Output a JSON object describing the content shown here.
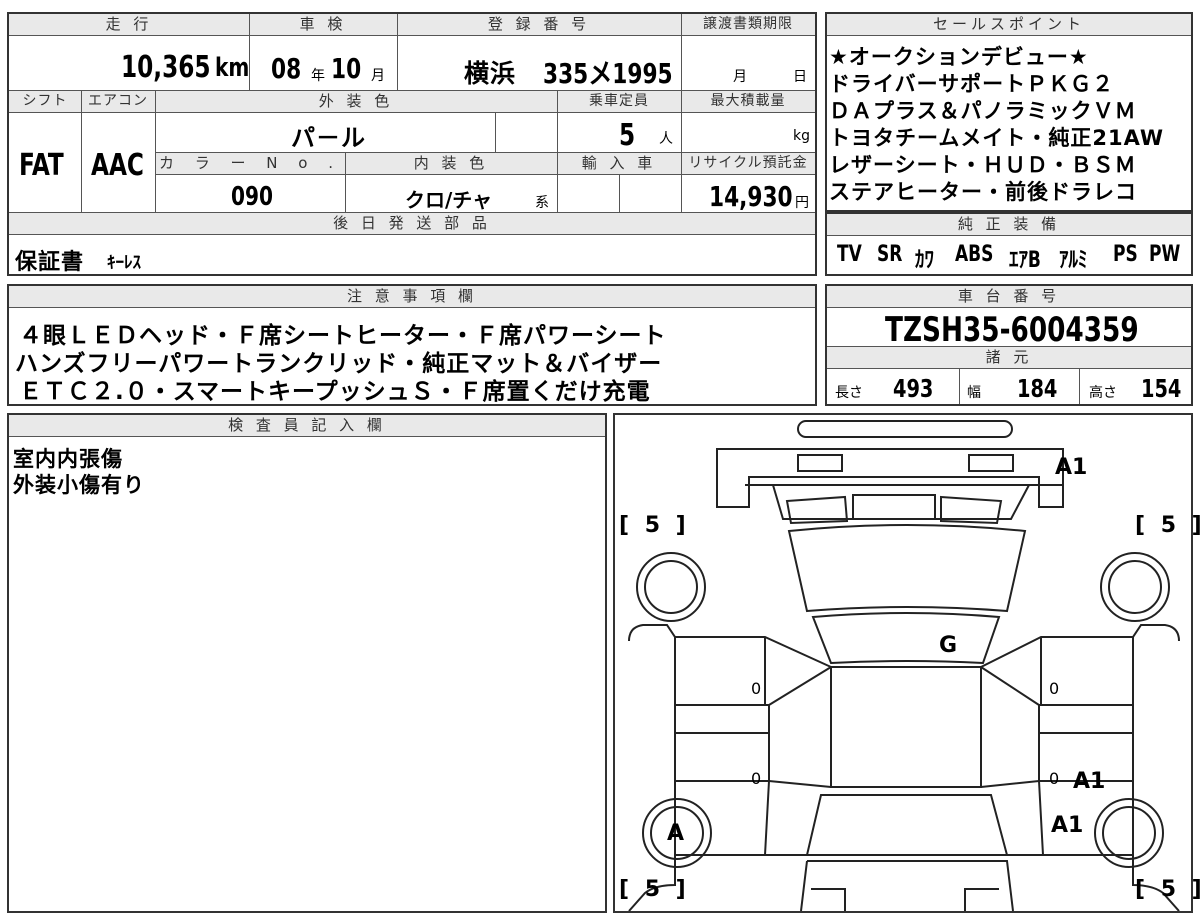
{
  "vehicle": {
    "header_mileage": "走 行",
    "mileage_value": "10,365",
    "mileage_unit": "km",
    "header_inspection": "車 検",
    "inspection_year": "08",
    "inspection_year_unit": "年",
    "inspection_month": "10",
    "inspection_month_unit": "月",
    "header_registration": "登 録 番 号",
    "registration_area": "横浜",
    "registration_number": "335メ1995",
    "header_transfer": "譲渡書類期限",
    "transfer_month_unit": "月",
    "transfer_day_unit": "日",
    "header_shift": "シフト",
    "header_aircon": "エアコン",
    "header_exterior_color": "外 装 色",
    "header_capacity": "乗車定員",
    "header_max_load": "最大積載量",
    "shift_value": "FAT",
    "aircon_value": "AAC",
    "exterior_color_value": "パ－ル",
    "capacity_value": "5",
    "capacity_unit": "人",
    "max_load_unit": "kg",
    "header_color_no": "カ ラ ー N o .",
    "header_interior_color": "内 装 色",
    "header_import": "輸 入 車",
    "header_recycle": "リサイクル預託金",
    "color_no_value": "090",
    "interior_color_value": "クロ/チャ",
    "interior_color_suffix": "系",
    "recycle_value": "14,930",
    "recycle_unit": "円",
    "header_later_parts": "後 日 発 送 部 品",
    "later_parts_value": "保証書",
    "later_parts_extra": "ｷｰﾚｽ"
  },
  "sales_points": {
    "header": "セールスポイント",
    "lines": [
      "★オークションデビュー★",
      "ドライバーサポートＰＫＧ２",
      "ＤＡプラス＆パノラミックＶＭ",
      "トヨタチームメイト・純正21AW",
      "レザーシート・ＨＵＤ・ＢＳＭ",
      "ステアヒーター・前後ドラレコ"
    ]
  },
  "equipment": {
    "header": "純 正 装 備",
    "items": [
      "TV",
      "SR",
      "ｶﾜ",
      "ABS",
      "ｴｱB",
      "ｱﾙﾐ",
      "PS",
      "PW"
    ]
  },
  "notes": {
    "header": "注 意 事 項 欄",
    "lines": [
      "４眼ＬＥＤヘッド・Ｆ席シートヒーター・Ｆ席パワーシート",
      "ハンズフリーパワートランクリッド・純正マット＆バイザー",
      "ＥＴＣ２.０・スマートキープッシュＳ・Ｆ席置くだけ充電"
    ]
  },
  "chassis": {
    "header": "車 台 番 号",
    "value": "TZSH35-6004359"
  },
  "specs": {
    "header": "諸 元",
    "length_label": "長さ",
    "length_value": "493",
    "width_label": "幅",
    "width_value": "184",
    "height_label": "高さ",
    "height_value": "154"
  },
  "inspector": {
    "header": "検 査 員 記 入 欄",
    "lines": [
      "室内内張傷",
      "外装小傷有り"
    ]
  },
  "diagram": {
    "tire_front_left": "[ 5 ]",
    "tire_front_right": "[ 5 ]",
    "tire_rear_left": "[ 5 ]",
    "tire_rear_right": "[ 5 ]",
    "mark_rear_bumper": "A1",
    "mark_windshield": "G",
    "mark_door_left_front": "0",
    "mark_door_left_rear": "0",
    "mark_door_right_front": "0",
    "mark_door_right_rear": "0",
    "mark_right_rear_door": "A1",
    "mark_right_rear_fender": "A1",
    "mark_left_rear_wheel": "A"
  }
}
